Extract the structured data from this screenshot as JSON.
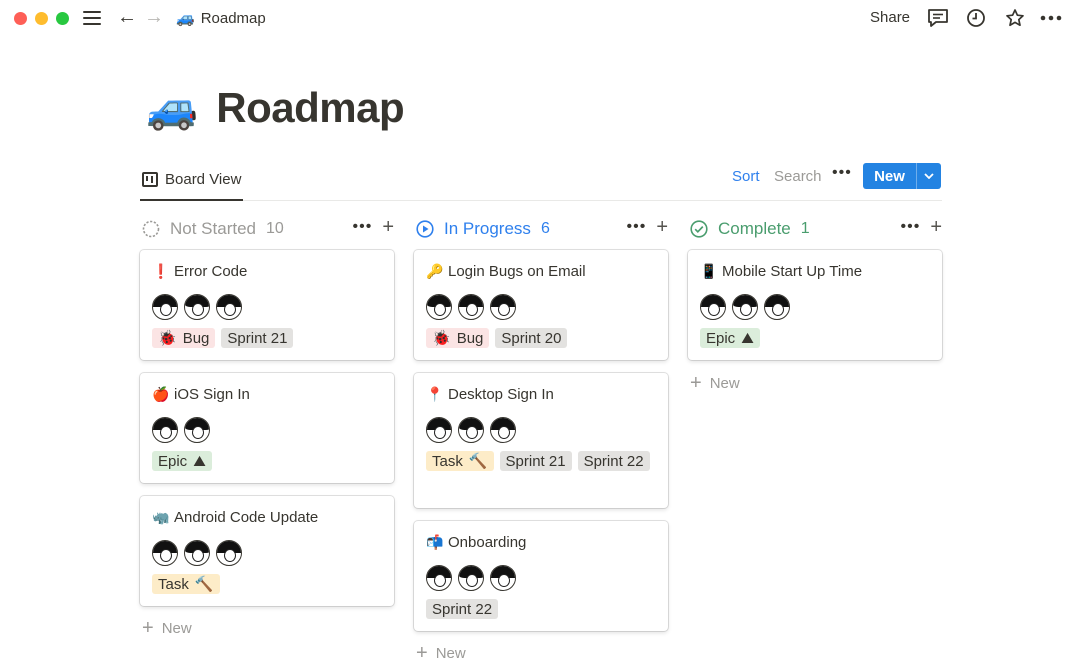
{
  "window": {
    "breadcrumb": {
      "icon": "🚙",
      "label": "Roadmap"
    },
    "share_label": "Share",
    "icons": [
      "comments-icon",
      "history-icon",
      "star-icon",
      "more-icon"
    ]
  },
  "page": {
    "emoji": "🚙",
    "title": "Roadmap"
  },
  "viewbar": {
    "tab_label": "Board View",
    "sort_label": "Sort",
    "search_label": "Search",
    "more_label": "•••",
    "new_label": "New"
  },
  "columns": [
    {
      "title": "Not Started",
      "count": "10",
      "color": "#9b9a97",
      "cards": [
        {
          "emoji": "❗",
          "title": "Error Code",
          "avatars": 3,
          "tags": [
            {
              "label": "Bug",
              "emoji": "🐞",
              "kind": "bug"
            },
            {
              "label": "Sprint 21",
              "kind": "sprint"
            }
          ]
        },
        {
          "emoji": "🍎",
          "title": "iOS Sign In",
          "avatars": 2,
          "tags": [
            {
              "label": "Epic",
              "emoji": "⛰",
              "kind": "epic"
            }
          ]
        },
        {
          "emoji": "🦏",
          "title": "Android Code Update",
          "avatars": 3,
          "tags": [
            {
              "label": "Task",
              "emoji": "🔨",
              "kind": "task"
            }
          ]
        }
      ],
      "new_label": "New"
    },
    {
      "title": "In Progress",
      "count": "6",
      "color": "#2f80ed",
      "cards": [
        {
          "emoji": "🔑",
          "title": "Login Bugs on Email",
          "avatars": 3,
          "tags": [
            {
              "label": "Bug",
              "emoji": "🐞",
              "kind": "bug"
            },
            {
              "label": "Sprint 20",
              "kind": "sprint"
            }
          ]
        },
        {
          "emoji": "📍",
          "title": "Desktop Sign In",
          "avatars": 3,
          "tags": [
            {
              "label": "Task",
              "emoji": "🔨",
              "kind": "task"
            },
            {
              "label": "Sprint 21",
              "kind": "sprint"
            },
            {
              "label": "Sprint 22",
              "kind": "sprint"
            }
          ]
        },
        {
          "emoji": "📬",
          "title": "Onboarding",
          "avatars": 3,
          "tags": [
            {
              "label": "Sprint 22",
              "kind": "sprint"
            }
          ]
        }
      ],
      "new_label": "New"
    },
    {
      "title": "Complete",
      "count": "1",
      "color": "#4a9d6e",
      "cards": [
        {
          "emoji": "📱",
          "title": "Mobile Start Up Time",
          "avatars": 3,
          "tags": [
            {
              "label": "Epic",
              "emoji": "⛰",
              "kind": "epic"
            }
          ]
        }
      ],
      "new_label": "New"
    }
  ]
}
